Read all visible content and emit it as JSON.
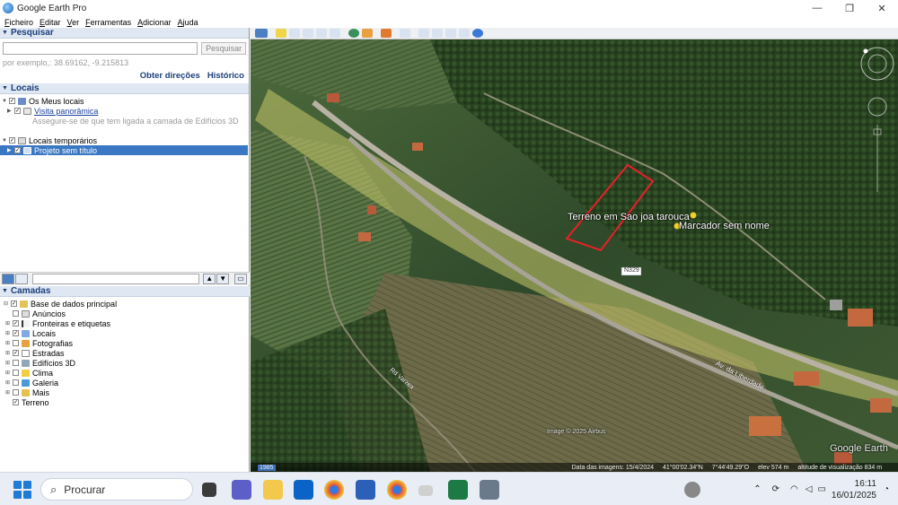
{
  "window": {
    "title": "Google Earth Pro",
    "minimize": "—",
    "maximize": "❐",
    "close": "✕"
  },
  "menu": [
    "Ficheiro",
    "Editar",
    "Ver",
    "Ferramentas",
    "Adicionar",
    "Ajuda"
  ],
  "search_panel": {
    "header": "Pesquisar",
    "input_value": "",
    "button": "Pesquisar",
    "hint": "por exemplo,: 38.69162, -9.215813",
    "link_directions": "Obter direções",
    "link_history": "Histórico"
  },
  "places_panel": {
    "header": "Locais",
    "items": [
      {
        "label": "Os Meus locais",
        "icon": "folder-icon"
      },
      {
        "label": "Visita panorâmica",
        "icon": "tour-icon"
      },
      {
        "label": "Assegure-se de que tem ligada a camada de Edifícios 3D",
        "icon": ""
      },
      {
        "label": "Locais temporários",
        "icon": "folder-icon"
      },
      {
        "label": "Projeto sem título",
        "icon": "project-icon"
      }
    ]
  },
  "layers_panel": {
    "header": "Camadas",
    "items": [
      {
        "label": "Base de dados principal",
        "checked": true
      },
      {
        "label": "Anúncios",
        "checked": false
      },
      {
        "label": "Fronteiras e etiquetas",
        "checked": true
      },
      {
        "label": "Locais",
        "checked": true
      },
      {
        "label": "Fotografias",
        "checked": false
      },
      {
        "label": "Estradas",
        "checked": true
      },
      {
        "label": "Edifícios 3D",
        "checked": false
      },
      {
        "label": "Clima",
        "checked": false
      },
      {
        "label": "Galeria",
        "checked": false
      },
      {
        "label": "Mais",
        "checked": false
      },
      {
        "label": "Terreno",
        "checked": true
      }
    ]
  },
  "map": {
    "polygon_label": "Terreno em Sao joa tarouca",
    "placemark_label": "Marcador sem nome",
    "road_label_1": "N329",
    "road_label_2": "Av. da Liberdade",
    "road_label_3": "Rd Varzea",
    "logo": "Google Earth",
    "image_credit": "Image © 2025 Airbus",
    "status": {
      "year": "1985",
      "imagery_date": "Data das imagens: 15/4/2024",
      "lat": "41°00'02.34\"N",
      "lon": "7°44'49.29\"O",
      "elev": "elev 574 m",
      "eye_alt": "altitude de visualização 834 m"
    },
    "colors": {
      "polygon_outline": "#e8202a",
      "road_highlight": "#c9c86a"
    }
  },
  "taskbar": {
    "search_placeholder": "Procurar",
    "time": "16:11",
    "date": "16/01/2025"
  }
}
